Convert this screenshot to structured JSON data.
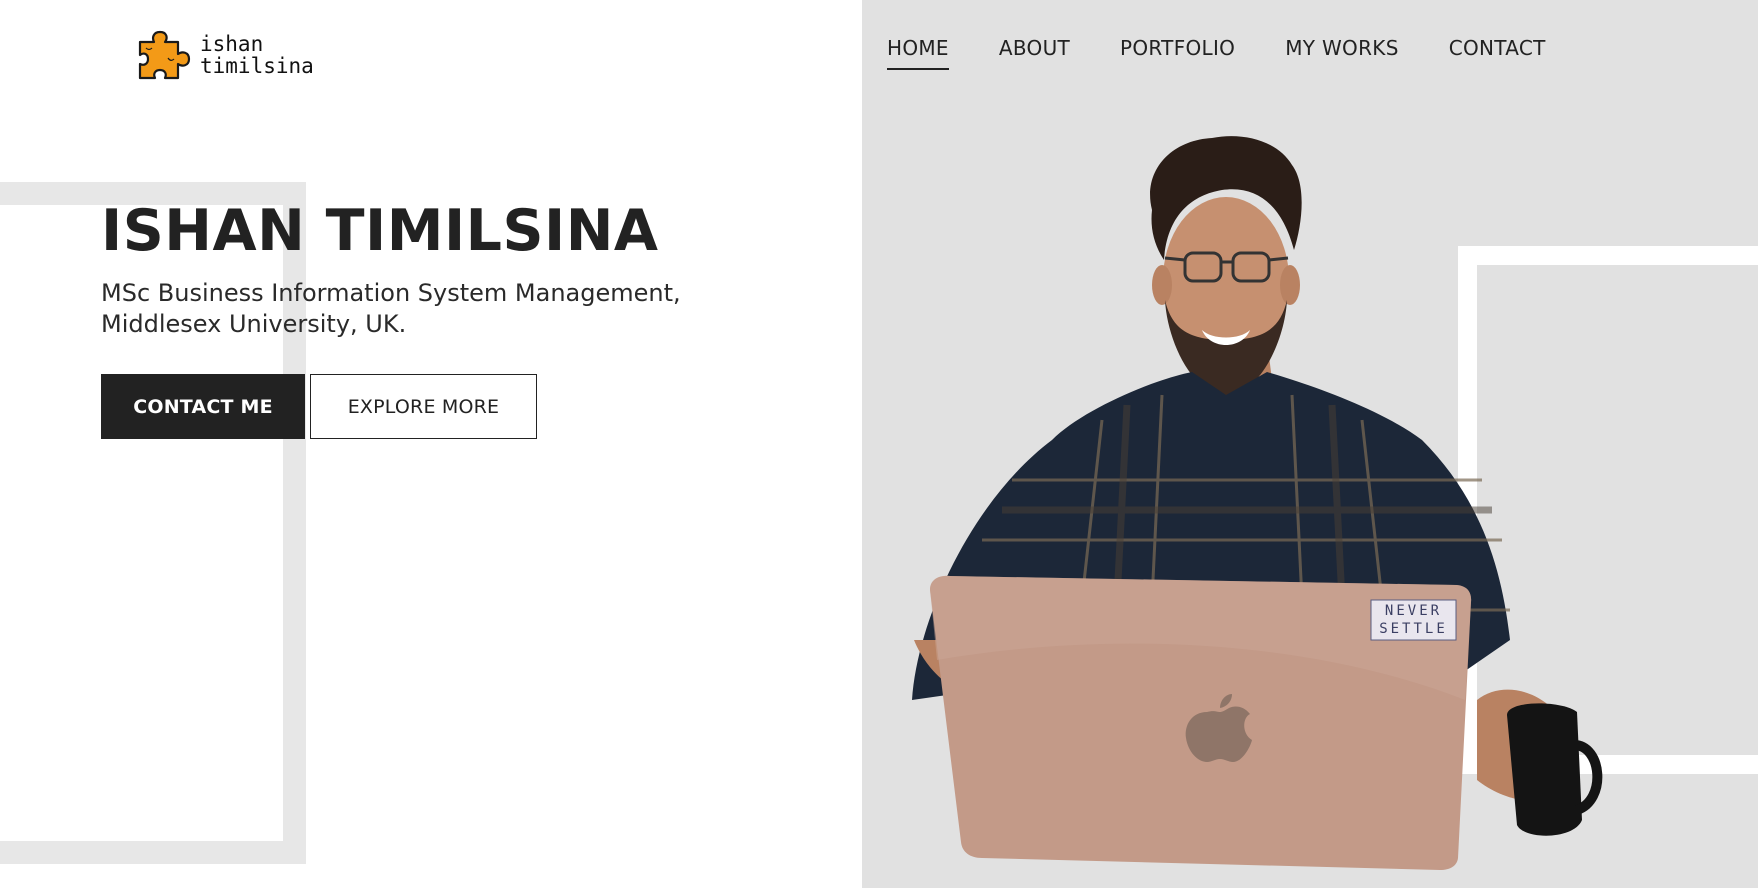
{
  "brand": {
    "logo_line1": "ishan",
    "logo_line2": "timilsina",
    "logo_icon": "puzzle-piece-icon"
  },
  "nav": {
    "items": [
      {
        "label": "HOME",
        "active": true
      },
      {
        "label": "ABOUT",
        "active": false
      },
      {
        "label": "PORTFOLIO",
        "active": false
      },
      {
        "label": "MY WORKS",
        "active": false
      },
      {
        "label": "CONTACT",
        "active": false
      }
    ]
  },
  "hero": {
    "name": "ISHAN TIMILSINA",
    "subtitle_line1": "MSc Business Information System Management,",
    "subtitle_line2": "Middlesex University, UK.",
    "primary_button": "CONTACT ME",
    "secondary_button": "EXPLORE MORE"
  },
  "photo": {
    "sticker_line1": "NEVER",
    "sticker_line2": "SETTLE"
  },
  "colors": {
    "dark": "#222222",
    "panel_gray": "#e1e1e1",
    "frame_gray": "#e7e7e7",
    "logo_orange": "#f39a17"
  }
}
